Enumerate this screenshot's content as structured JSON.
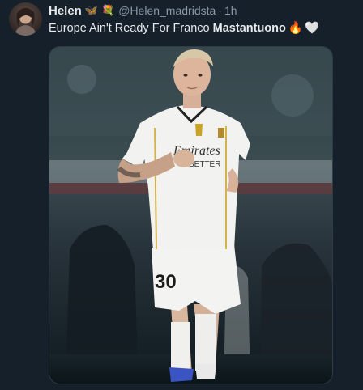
{
  "tweet": {
    "author": {
      "name": "Helen",
      "emoji_1": "🦋",
      "emoji_2": "💐",
      "handle": "@Helen_madridsta",
      "separator": "·",
      "time": "1h",
      "avatar_icon": "profile-photo"
    },
    "text": {
      "plain": "Europe Ain't Ready For Franco ",
      "bold": "Mastantuono",
      "emoji_fire": "🔥",
      "emoji_heart": "🤍"
    },
    "media": {
      "jersey_sponsor_line1": "Emirates",
      "jersey_sponsor_line2": "BETTER",
      "shorts_number": "30"
    }
  },
  "colors": {
    "background": "#15202b",
    "text_primary": "#e7e9ea",
    "text_secondary": "#8b98a5",
    "kit_white": "#f2f2f0",
    "kit_gold": "#c9a227"
  }
}
